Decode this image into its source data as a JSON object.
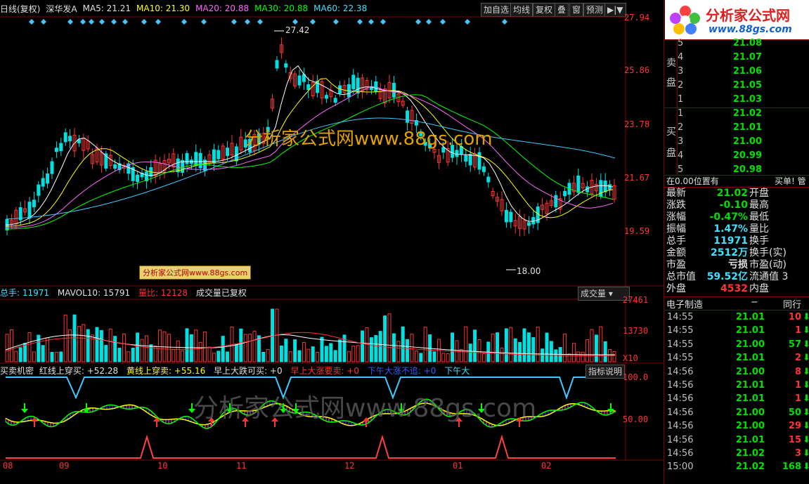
{
  "colors": {
    "up": "#ff3333",
    "down": "#00e0e0",
    "bg": "#000000",
    "grid": "#800000"
  },
  "header": {
    "period": "日线(复权)",
    "stock": "深华发A",
    "ma5": "MA5: 21.21",
    "ma10": "MA10: 21.30",
    "ma20": "MA20: 20.88",
    "ma30": "MA30: 20.88",
    "ma60": "MA60: 22.38",
    "buttons": [
      "加自选",
      "均线",
      "复权",
      "叠",
      "窗",
      "预测",
      "▶|▼"
    ]
  },
  "price_axis": [
    "27.94",
    "25.86",
    "23.78",
    "21.67",
    "19.59"
  ],
  "price_annotations": {
    "high": "27.42",
    "low": "18.00"
  },
  "watermarks": {
    "main": "分析家公式网www.88gs.com",
    "small": "分析家公式网www.88gs.com",
    "bottom": "分析家公式网www.88gs.com"
  },
  "volume_panel": {
    "total": "总手: 11971",
    "mavol": "MAVOL10: 15791",
    "ratio": "量比: 12128",
    "note": "成交量已复权",
    "selector": "成交量",
    "axis": [
      "27461",
      "13730",
      "X10"
    ]
  },
  "indicator_panel": {
    "name": "买卖机密",
    "l1": "红线上穿买: +52.28",
    "l2": "黄线上穿卖: +55.16",
    "l3": "早上大跌可买: +0",
    "l4": "早上大涨要卖: +0",
    "l5": "下午大涨不追: +0",
    "l6": "下午大",
    "button": "指标说明",
    "axis": [
      "100.0",
      "50.00"
    ]
  },
  "time_axis": [
    "08",
    "09",
    "10",
    "11",
    "12",
    "01",
    "02"
  ],
  "logo": {
    "title": "分析家公式网",
    "url": "www.88gs.com"
  },
  "order_book": {
    "sell_label": [
      "卖",
      "盘"
    ],
    "buy_label": [
      "买",
      "盘"
    ],
    "sells": [
      {
        "lv": "5",
        "price": "21.08"
      },
      {
        "lv": "4",
        "price": "21.07"
      },
      {
        "lv": "3",
        "price": "21.06"
      },
      {
        "lv": "2",
        "price": "21.05"
      },
      {
        "lv": "1",
        "price": "21.03"
      }
    ],
    "buys": [
      {
        "lv": "1",
        "price": "21.02"
      },
      {
        "lv": "2",
        "price": "21.01"
      },
      {
        "lv": "3",
        "price": "21.00"
      },
      {
        "lv": "4",
        "price": "20.99"
      },
      {
        "lv": "5",
        "price": "20.98"
      }
    ]
  },
  "position": {
    "text": "在0.00位置有",
    "action": "买单! 管"
  },
  "quotes": [
    {
      "l": "最新",
      "v": "21.02",
      "vc": "dn",
      "r": "开盘"
    },
    {
      "l": "涨跌",
      "v": "-0.10",
      "vc": "dn",
      "r": "最高"
    },
    {
      "l": "涨幅",
      "v": "-0.47%",
      "vc": "dn",
      "r": "最低"
    },
    {
      "l": "振幅",
      "v": "1.47%",
      "vc": "cy",
      "r": "量比"
    },
    {
      "l": "总手",
      "v": "11971",
      "vc": "cy",
      "r": "换手"
    },
    {
      "l": "金额",
      "v": "2512万",
      "vc": "cy",
      "r": "换手(实)"
    },
    {
      "l": "市盈",
      "v": "亏损",
      "vc": "wh",
      "r": "市盈(动)"
    },
    {
      "l": "总市值",
      "v": "59.52亿",
      "vc": "cy",
      "r": "流通值 3"
    },
    {
      "l": "外盘",
      "v": "4532",
      "vc": "up",
      "r": "内盘"
    }
  ],
  "industry": {
    "name": "电子制造",
    "minus": "−",
    "peer": "同行"
  },
  "ticks": [
    {
      "t": "14:55",
      "p": "21.01",
      "v": "10",
      "d": "dn"
    },
    {
      "t": "14:55",
      "p": "21.01",
      "v": "1",
      "d": "dn"
    },
    {
      "t": "14:55",
      "p": "21.00",
      "v": "57",
      "d": "dn"
    },
    {
      "t": "14:55",
      "p": "21.01",
      "v": "2",
      "d": "dn"
    },
    {
      "t": "14:56",
      "p": "21.00",
      "v": "8",
      "d": "dn"
    },
    {
      "t": "14:56",
      "p": "21.01",
      "v": "1",
      "d": "dn"
    },
    {
      "t": "14:56",
      "p": "21.01",
      "v": "1",
      "d": "dn"
    },
    {
      "t": "14:56",
      "p": "21.00",
      "v": "50",
      "d": "dn"
    },
    {
      "t": "14:56",
      "p": "21.00",
      "v": "29",
      "d": "dn"
    },
    {
      "t": "14:56",
      "p": "21.01",
      "v": "15",
      "d": "dn"
    },
    {
      "t": "14:56",
      "p": "21.02",
      "v": "3",
      "d": "dn"
    },
    {
      "t": "15:00",
      "p": "21.02",
      "v": "168",
      "d": "dn"
    }
  ]
}
